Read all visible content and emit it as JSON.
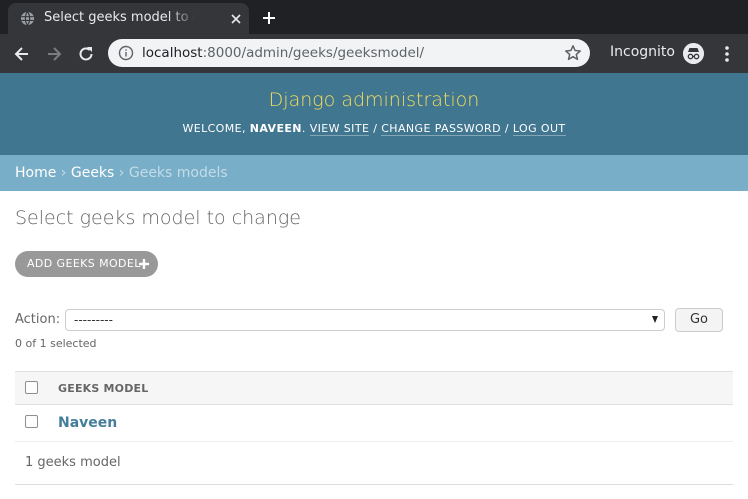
{
  "browser": {
    "tab_title": "Select geeks model to change | Django site admin",
    "url_host": "localhost",
    "url_rest": ":8000/admin/geeks/geeksmodel/",
    "incognito_label": "Incognito"
  },
  "header": {
    "branding": "Django administration",
    "welcome": "WELCOME,",
    "username": "NAVEEN",
    "view_site": "VIEW SITE",
    "change_password": "CHANGE PASSWORD",
    "log_out": "LOG OUT",
    "separator": "/"
  },
  "breadcrumbs": {
    "home": "Home",
    "app": "Geeks",
    "current": "Geeks models",
    "separator": "›"
  },
  "content": {
    "title": "Select geeks model to change",
    "add_button": "ADD GEEKS MODEL"
  },
  "actions": {
    "label": "Action:",
    "selected_option": "---------",
    "go_button": "Go",
    "counter": "0 of 1 selected"
  },
  "results": {
    "column_header": "GEEKS MODEL",
    "rows": [
      {
        "name": "Naveen"
      }
    ],
    "paginator": "1 geeks model"
  },
  "colors": {
    "header_bg": "#417690",
    "branding": "#f5dd5d",
    "breadcrumbs_bg": "#79aec8",
    "link": "#447e9b"
  }
}
